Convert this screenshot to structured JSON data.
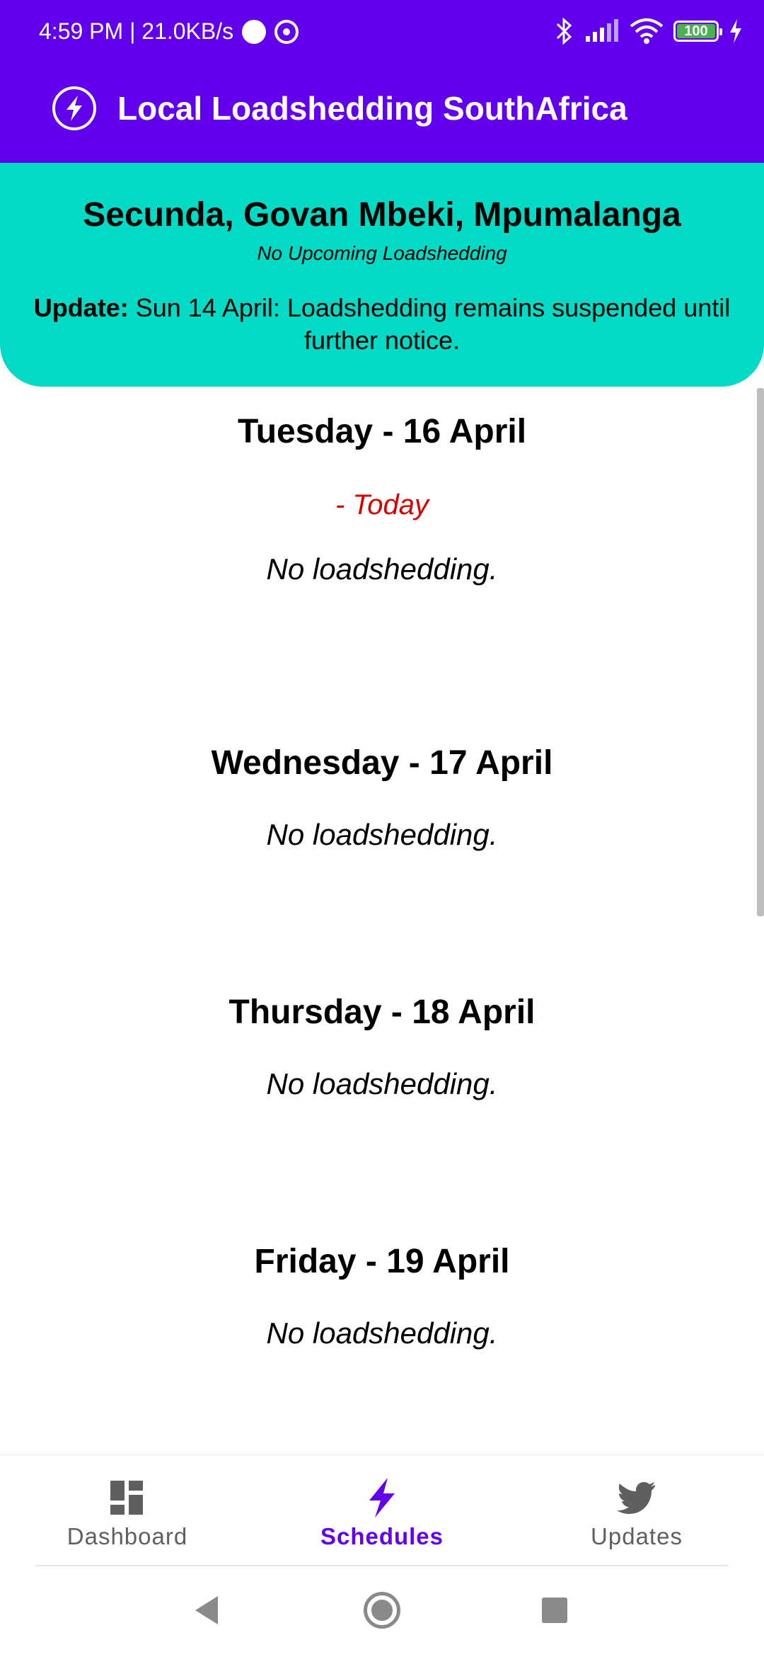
{
  "status_bar": {
    "time_speed": "4:59 PM | 21.0KB/s",
    "battery": "100",
    "battery_level": 1.0
  },
  "app": {
    "title": "Local Loadshedding SouthAfrica",
    "logo_icon": "lightning-bolt-icon",
    "primary_color": "#6200EE",
    "accent_color": "#03DAC5"
  },
  "banner": {
    "location": "Secunda, Govan Mbeki, Mpumalanga",
    "upcoming": "No Upcoming Loadshedding",
    "update_label": "Update:",
    "update_text": " Sun 14 April: Loadshedding remains suspended until further notice."
  },
  "schedule": {
    "days": [
      {
        "title": "Tuesday - 16 April",
        "today_label": "- Today",
        "status": "No loadshedding."
      },
      {
        "title": "Wednesday - 17 April",
        "status": "No loadshedding."
      },
      {
        "title": "Thursday - 18 April",
        "status": "No loadshedding."
      },
      {
        "title": "Friday - 19 April",
        "status": "No loadshedding."
      }
    ],
    "today_color": "#D50000"
  },
  "bottom_nav": {
    "items": [
      {
        "label": "Dashboard",
        "icon": "dashboard-icon",
        "active": false
      },
      {
        "label": "Schedules",
        "icon": "lightning-bolt-icon",
        "active": true
      },
      {
        "label": "Updates",
        "icon": "twitter-bird-icon",
        "active": false
      }
    ]
  },
  "system_nav": {
    "back_icon": "back-triangle-icon",
    "home_icon": "home-circle-icon",
    "recents_icon": "recents-square-icon"
  }
}
